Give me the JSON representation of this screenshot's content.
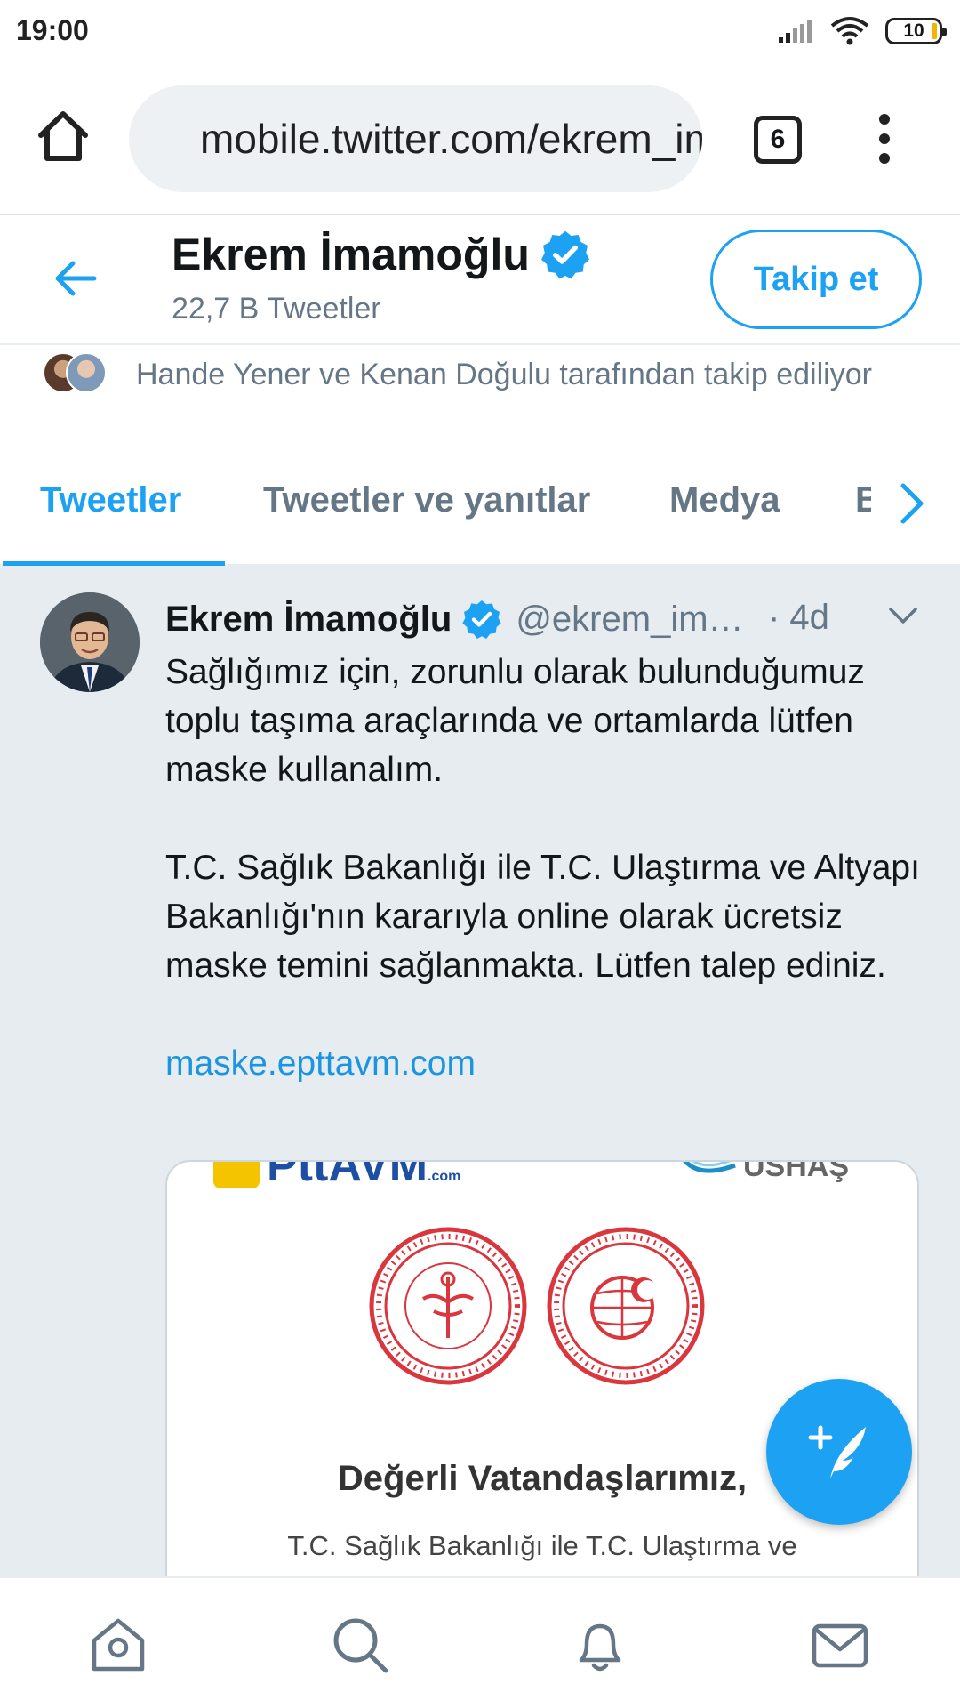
{
  "status_bar": {
    "time": "19:00",
    "battery": "10",
    "icons": [
      "signal-icon",
      "wifi-icon",
      "battery-icon"
    ]
  },
  "browser": {
    "url": "mobile.twitter.com/ekrem_imamoglu",
    "tab_count": "6",
    "icons": [
      "home-icon",
      "lock-icon",
      "more-vert-icon"
    ]
  },
  "profile": {
    "name": "Ekrem İmamoğlu",
    "tweet_count": "22,7 B Tweetler",
    "follow_label": "Takip et",
    "followed_by": "Hande Yener ve Kenan Doğulu tarafından takip ediliyor"
  },
  "tabs": [
    {
      "label": "Tweetler",
      "active": true
    },
    {
      "label": "Tweetler ve yanıtlar",
      "active": false
    },
    {
      "label": "Medya",
      "active": false
    },
    {
      "label": "Beğeni",
      "active": false
    }
  ],
  "tweet": {
    "name": "Ekrem İmamoğlu",
    "handle": "@ekrem_im…",
    "time": "· 4d",
    "paragraph1": "Sağlığımız için, zorunlu olarak bulunduğumuz toplu taşıma araçlarında ve ortamlarda lütfen maske kullanalım.",
    "paragraph2": "T.C. Sağlık Bakanlığı ile T.C. Ulaştırma ve Altyapı Bakanlığı'nın kararıyla online olarak ücretsiz maske temini sağlanmakta. Lütfen talep ediniz.",
    "link": "maske.epttavm.com"
  },
  "media_card": {
    "logo_left": "PttAVM",
    "logo_left_suffix": ".com",
    "logo_right": "USHAŞ",
    "heading": "Değerli Vatandaşlarımız,",
    "subtext": "T.C. Sağlık Bakanlığı ile T.C. Ulaştırma ve"
  },
  "bottom_nav": [
    "home-nav-icon",
    "search-nav-icon",
    "notifications-nav-icon",
    "messages-nav-icon"
  ],
  "colors": {
    "twitter_blue": "#1da1f2",
    "link_blue": "#1b95e0",
    "secondary_text": "#657786",
    "timeline_bg": "#e6ecf0",
    "seal_red": "#d9363e",
    "ptt_yellow": "#f5c400"
  }
}
